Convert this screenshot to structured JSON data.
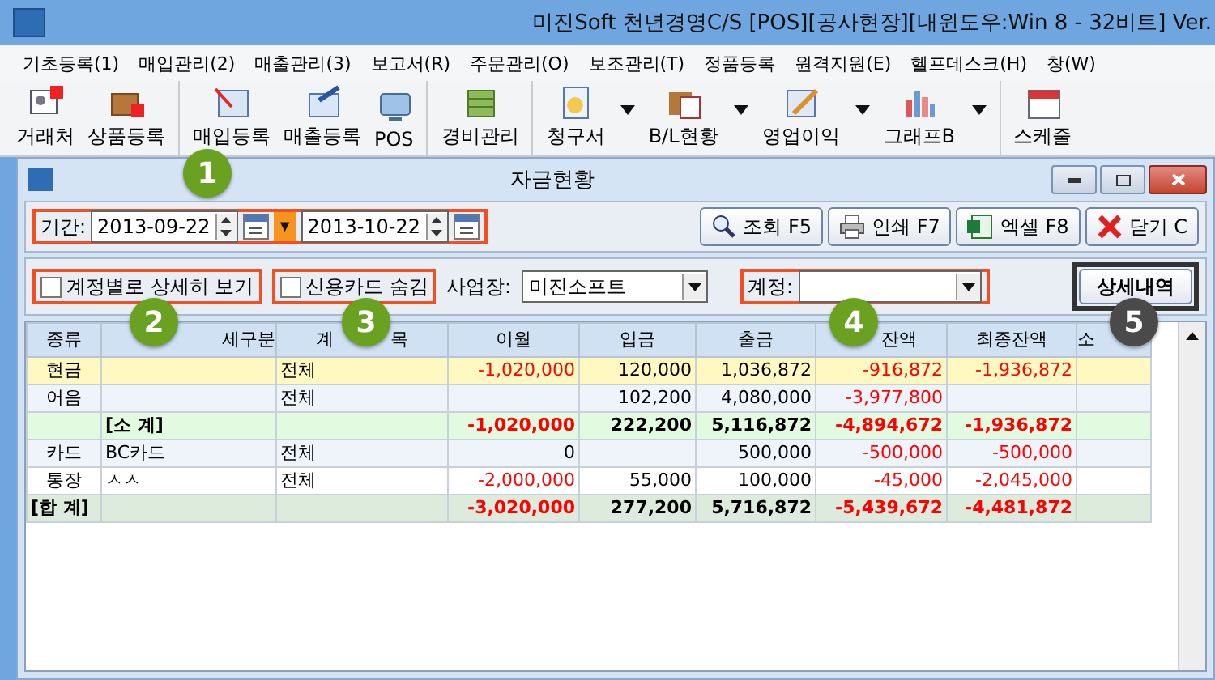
{
  "window": {
    "title": "미진Soft 천년경영C/S [POS][공사현장][내윈도우:Win 8 - 32비트] Ver."
  },
  "menu": [
    "기초등록(1)",
    "매입관리(2)",
    "매출관리(3)",
    "보고서(R)",
    "주문관리(O)",
    "보조관리(T)",
    "정품등록",
    "원격지원(E)",
    "헬프데스크(H)",
    "창(W)"
  ],
  "toolbar": [
    {
      "label": "거래처",
      "dropdown": false,
      "group_start": false
    },
    {
      "label": "상품등록",
      "dropdown": false,
      "group_start": false
    },
    {
      "label": "매입등록",
      "dropdown": false,
      "group_start": true
    },
    {
      "label": "매출등록",
      "dropdown": false,
      "group_start": false
    },
    {
      "label": "POS",
      "dropdown": false,
      "group_start": false
    },
    {
      "label": "경비관리",
      "dropdown": false,
      "group_start": true
    },
    {
      "label": "청구서",
      "dropdown": true,
      "group_start": true
    },
    {
      "label": "B/L현황",
      "dropdown": true,
      "group_start": false
    },
    {
      "label": "영업이익",
      "dropdown": true,
      "group_start": false
    },
    {
      "label": "그래프B",
      "dropdown": true,
      "group_start": false
    },
    {
      "label": "스케줄",
      "dropdown": false,
      "group_start": true
    }
  ],
  "child_window": {
    "title": "자금현황",
    "period": {
      "label": "기간:",
      "from": "2013-09-22",
      "to": "2013-10-22",
      "separator": "▼"
    },
    "buttons": [
      "조회 F5",
      "인쇄 F7",
      "엑셀 F8",
      "닫기 C"
    ],
    "options": [
      {
        "label": "계정별로 상세히 보기",
        "checked": false
      },
      {
        "label": "신용카드 숨김",
        "checked": false
      }
    ],
    "business": {
      "label": "사업장:",
      "value": "미진소프트"
    },
    "account": {
      "label": "계정:"
    },
    "detail_button": "상세내역",
    "table": {
      "columns": [
        "종류",
        "세구분",
        "계          목",
        "이월",
        "입금",
        "출금",
        "잔액",
        "최종잔액",
        "소"
      ],
      "rows": [
        {
          "kind": "normal",
          "selected": true,
          "cells": [
            {
              "text": "현금",
              "negative": false
            },
            null,
            {
              "text": "전체",
              "negative": false
            },
            {
              "text": "-1,020,000",
              "negative": true
            },
            {
              "text": "120,000",
              "negative": false
            },
            {
              "text": "1,036,872",
              "negative": false
            },
            {
              "text": "-916,872",
              "negative": true
            },
            {
              "text": "-1,936,872",
              "negative": true
            },
            null
          ]
        },
        {
          "kind": "normal",
          "selected": false,
          "cells": [
            {
              "text": "어음",
              "negative": false
            },
            null,
            {
              "text": "전체",
              "negative": false
            },
            null,
            {
              "text": "102,200",
              "negative": false
            },
            {
              "text": "4,080,000",
              "negative": false
            },
            {
              "text": "-3,977,800",
              "negative": true
            },
            null,
            null
          ]
        },
        {
          "kind": "subtotal",
          "selected": false,
          "cells": [
            null,
            {
              "text": "[소 계]",
              "negative": false
            },
            null,
            {
              "text": "-1,020,000",
              "negative": true
            },
            {
              "text": "222,200",
              "negative": false
            },
            {
              "text": "5,116,872",
              "negative": false
            },
            {
              "text": "-4,894,672",
              "negative": true
            },
            {
              "text": "-1,936,872",
              "negative": true
            },
            null
          ]
        },
        {
          "kind": "normal",
          "selected": false,
          "cells": [
            {
              "text": "카드",
              "negative": false
            },
            {
              "text": "BC카드",
              "negative": false
            },
            {
              "text": "전체",
              "negative": false
            },
            {
              "text": "0",
              "negative": false
            },
            null,
            {
              "text": "500,000",
              "negative": false
            },
            {
              "text": "-500,000",
              "negative": true
            },
            {
              "text": "-500,000",
              "negative": true
            },
            null
          ]
        },
        {
          "kind": "normal",
          "selected": false,
          "cells": [
            {
              "text": "통장",
              "negative": false
            },
            {
              "text": "ㅅㅅ",
              "negative": false
            },
            {
              "text": "전체",
              "negative": false
            },
            {
              "text": "-2,000,000",
              "negative": true
            },
            {
              "text": "55,000",
              "negative": false
            },
            {
              "text": "100,000",
              "negative": false
            },
            {
              "text": "-45,000",
              "negative": true
            },
            {
              "text": "-2,045,000",
              "negative": true
            },
            null
          ]
        },
        {
          "kind": "total",
          "selected": false,
          "cells": [
            {
              "text": "[합 계]",
              "negative": false
            },
            null,
            null,
            {
              "text": "-3,020,000",
              "negative": true
            },
            {
              "text": "277,200",
              "negative": false
            },
            {
              "text": "5,716,872",
              "negative": false
            },
            {
              "text": "-5,439,672",
              "negative": true
            },
            {
              "text": "-4,481,872",
              "negative": true
            },
            null
          ]
        }
      ]
    }
  },
  "callouts": [
    {
      "number": "1",
      "color": "#6aa121"
    },
    {
      "number": "2",
      "color": "#6aa121"
    },
    {
      "number": "3",
      "color": "#6aa121"
    },
    {
      "number": "4",
      "color": "#6aa121"
    },
    {
      "number": "5",
      "color": "#4a4a4a"
    }
  ]
}
